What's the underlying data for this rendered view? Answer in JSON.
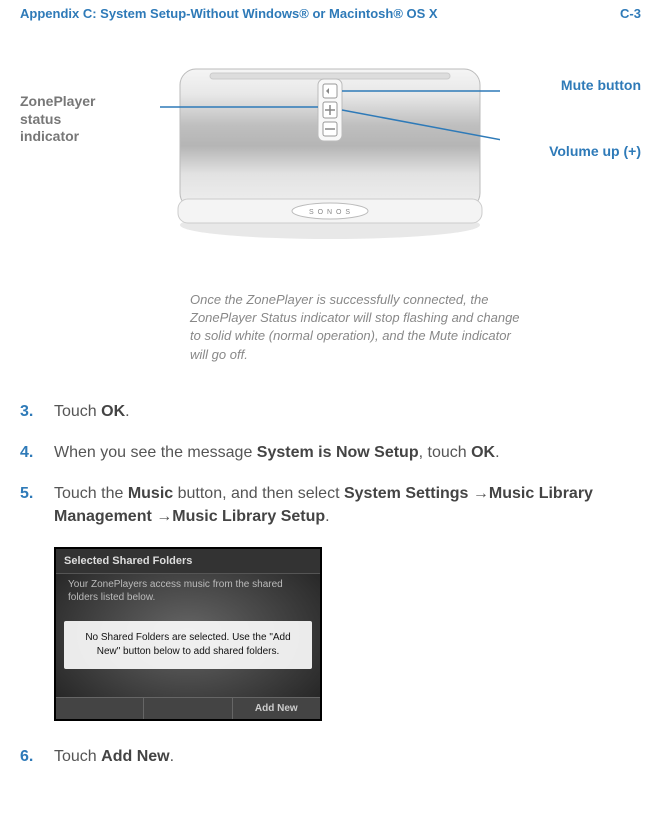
{
  "header": {
    "left": "Appendix C:  System Setup-Without Windows® or Macintosh® OS X",
    "right": "C-3"
  },
  "diagram": {
    "left_label_l1": "ZonePlayer",
    "left_label_l2": "status",
    "left_label_l3": "indicator",
    "right_label_mute": "Mute button",
    "right_label_vol": "Volume up (+)",
    "logo_text": "S O N O S",
    "caption": "Once the ZonePlayer is successfully connected, the ZonePlayer Status indicator will stop flashing and change to solid white (normal operation), and the Mute indicator will go off."
  },
  "steps": {
    "s3": {
      "num": "3.",
      "pre": "Touch ",
      "b1": "OK",
      "post": "."
    },
    "s4": {
      "num": "4.",
      "pre": "When you see the message ",
      "b1": "System is Now Setup",
      "mid": ", touch ",
      "b2": "OK",
      "post": "."
    },
    "s5": {
      "num": "5.",
      "pre": "Touch the ",
      "b1": "Music",
      "mid1": " button, and then select ",
      "b2": "System Settings",
      "arrow1": " →",
      "b3": "Music Library Management",
      "arrow2": " →",
      "b4": "Music Library Setup",
      "post": "."
    },
    "s6": {
      "num": "6.",
      "pre": "Touch ",
      "b1": "Add New",
      "post": "."
    }
  },
  "screenshot": {
    "title": "Selected Shared Folders",
    "sub": "Your ZonePlayers access music from the shared folders listed below.",
    "msg": "No Shared Folders are selected. Use the \"Add New\" button below to add shared folders.",
    "btn_add": "Add New"
  }
}
